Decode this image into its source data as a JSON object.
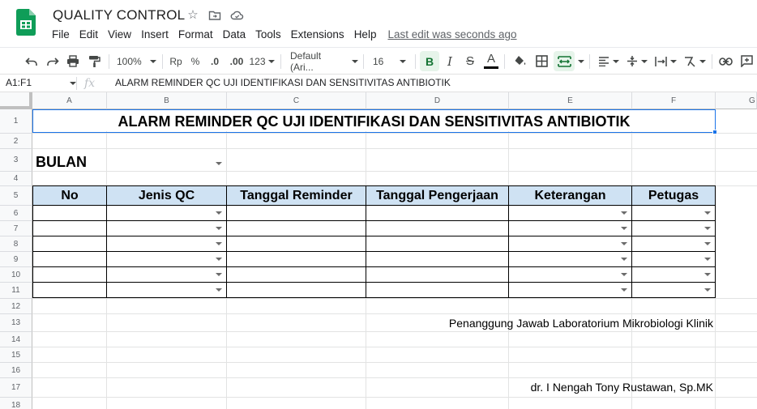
{
  "app": {
    "title": "QUALITY CONTROL",
    "last_edit": "Last edit was seconds ago",
    "menu": [
      "File",
      "Edit",
      "View",
      "Insert",
      "Format",
      "Data",
      "Tools",
      "Extensions",
      "Help"
    ]
  },
  "toolbar": {
    "zoom": "100%",
    "currency": "Rp",
    "percent": "%",
    "decrease_decimal": ".0",
    "increase_decimal": ".00",
    "more_formats": "123",
    "font": "Default (Ari...",
    "font_size": "16",
    "icons": [
      "undo-icon",
      "redo-icon",
      "print-icon",
      "paint-format-icon",
      "bold-icon",
      "italic-icon",
      "strikethrough-icon",
      "text-color-icon",
      "fill-color-icon",
      "borders-icon",
      "merge-cells-icon",
      "align-horizontal-icon",
      "align-vertical-icon",
      "text-wrap-icon",
      "text-rotation-icon",
      "link-icon",
      "comment-icon"
    ],
    "accent_color": "#1a73e8",
    "active_bg": "#e6f4ea"
  },
  "formula_bar": {
    "name_box": "A1:F1",
    "fx": "fx",
    "content": "ALARM REMINDER QC UJI IDENTIFIKASI DAN SENSITIVITAS ANTIBIOTIK"
  },
  "columns": [
    "A",
    "B",
    "C",
    "D",
    "E",
    "F",
    "G"
  ],
  "rows": [
    "1",
    "2",
    "3",
    "4",
    "5",
    "6",
    "7",
    "8",
    "9",
    "10",
    "11",
    "12",
    "13",
    "14",
    "15",
    "16",
    "17",
    "18"
  ],
  "sheet": {
    "title": "ALARM REMINDER QC UJI IDENTIFIKASI DAN SENSITIVITAS ANTIBIOTIK",
    "bulan_label": "BULAN",
    "table_headers": [
      "No",
      "Jenis QC",
      "Tanggal Reminder",
      "Tanggal Pengerjaan",
      "Keterangan",
      "Petugas"
    ],
    "header_color": "#cfe2f3",
    "signature_title": "Penanggung Jawab Laboratorium Mikrobiologi Klinik",
    "signature_name": "dr. I Nengah Tony Rustawan, Sp.MK"
  }
}
